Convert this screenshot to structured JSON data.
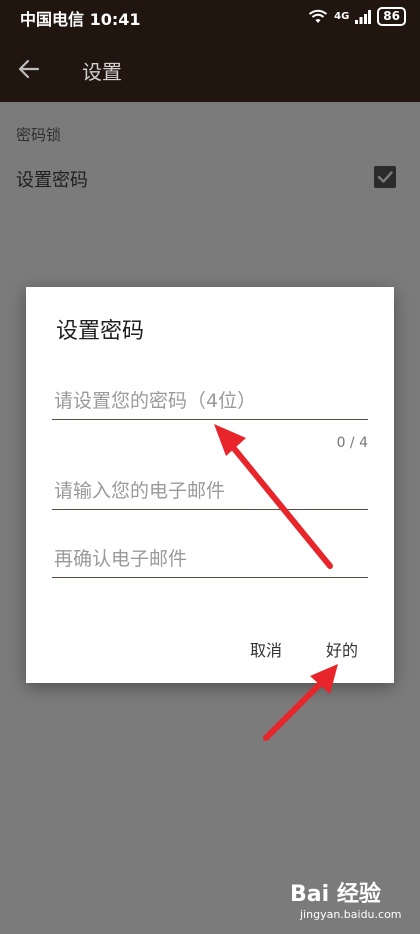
{
  "status_bar": {
    "carrier_time": "中国电信 10:41",
    "network": "4G",
    "battery": "86"
  },
  "app_bar": {
    "title": "设置"
  },
  "settings": {
    "section_label": "密码锁",
    "row_label": "设置密码",
    "row_checked": true
  },
  "dialog": {
    "title": "设置密码",
    "password_placeholder": "请设置您的密码（4位）",
    "password_counter": "0 / 4",
    "email_placeholder": "请输入您的电子邮件",
    "email_confirm_placeholder": "再确认电子邮件",
    "cancel_label": "取消",
    "ok_label": "好的"
  },
  "watermark": {
    "logo_text": "Bai 经验",
    "url": "jingyan.baidu.com"
  },
  "colors": {
    "appbar": "#20160f",
    "scrim_bg": "#7b7b7b",
    "accent_underline": "#5b4a3d",
    "annotation_arrow": "#e8252a"
  }
}
